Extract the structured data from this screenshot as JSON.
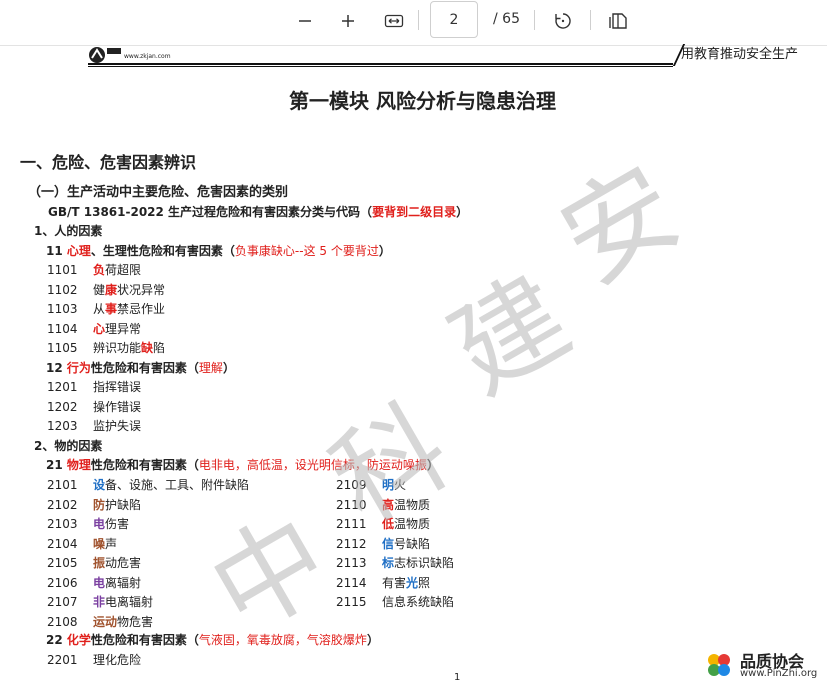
{
  "toolbar": {
    "zoom_out_icon": "minus-icon",
    "zoom_in_icon": "plus-icon",
    "fit_width_icon": "fit-width-icon",
    "page_current": "2",
    "page_total": "/ 65",
    "rotate_icon": "rotate-icon",
    "two_page_icon": "page-view-icon"
  },
  "header": {
    "logo_url": "www.zkjan.com",
    "motto": "用教育推动安全生产"
  },
  "doc": {
    "title": "第一模块   风险分析与隐患治理",
    "sec1": "一、危险、危害因素辨识",
    "sub1": "（一）生产活动中主要危险、危害因素的类别",
    "std_a": "GB/T 13861-2022 生产过程危险和有害因素分类与代码（",
    "std_b": "要背到二级目录",
    "std_c": "）",
    "p1": "1、人的因素",
    "g11_code": "11 ",
    "g11_a": "心理",
    "g11_b": "、生理性危险和有害因素（",
    "g11_c": "负事康缺心--这 5 个要背过",
    "g11_d": "）",
    "items11": [
      {
        "code": "1101",
        "pre": "",
        "hl": "负",
        "post": "荷超限"
      },
      {
        "code": "1102",
        "pre": "健",
        "hl": "康",
        "post": "状况异常"
      },
      {
        "code": "1103",
        "pre": "从",
        "hl": "事",
        "post": "禁忌作业"
      },
      {
        "code": "1104",
        "pre": "",
        "hl": "心",
        "post": "理异常"
      },
      {
        "code": "1105",
        "pre": "辨识功能",
        "hl": "缺",
        "post": "陷"
      }
    ],
    "g12_code": "12  ",
    "g12_a": "行为",
    "g12_b": "性危险和有害因素（",
    "g12_c": "理解",
    "g12_d": "）",
    "items12": [
      {
        "code": "1201",
        "text": "指挥错误"
      },
      {
        "code": "1202",
        "text": "操作错误"
      },
      {
        "code": "1203",
        "text": "监护失误"
      }
    ],
    "p2": "2、物的因素",
    "g21_code": "21  ",
    "g21_a": "物理",
    "g21_b": "性危险和有害因素（",
    "g21_c": "电非电，高低温，设光明信标，防运动噪振",
    "g21_d": "）",
    "items21_left": [
      {
        "code": "2101",
        "hl": "设",
        "post": "备、设施、工具、附件缺陷",
        "color": "blue"
      },
      {
        "code": "2102",
        "hl": "防",
        "post": "护缺陷",
        "color": "brown"
      },
      {
        "code": "2103",
        "hl": "电",
        "post": "伤害",
        "color": "purple"
      },
      {
        "code": "2104",
        "hl": "噪",
        "post": "声",
        "color": "brown"
      },
      {
        "code": "2105",
        "hl": "振",
        "post": "动危害",
        "color": "brown"
      },
      {
        "code": "2106",
        "hl": "电",
        "post": "离辐射",
        "color": "purple"
      },
      {
        "code": "2107",
        "hl": "非",
        "post": "电离辐射",
        "color": "purple"
      },
      {
        "code": "2108",
        "hl": "运动",
        "post": "物危害",
        "color": "brown"
      }
    ],
    "items21_right": [
      {
        "code": "2109",
        "pre": "",
        "hl": "明",
        "post": "火",
        "color": "blue"
      },
      {
        "code": "2110",
        "pre": "",
        "hl": "高",
        "post": "温物质",
        "color": "red"
      },
      {
        "code": "2111",
        "pre": "",
        "hl": "低",
        "post": "温物质",
        "color": "red"
      },
      {
        "code": "2112",
        "pre": "",
        "hl": "信",
        "post": "号缺陷",
        "color": "blue"
      },
      {
        "code": "2113",
        "pre": "",
        "hl": "标",
        "post": "志标识缺陷",
        "color": "blue"
      },
      {
        "code": "2114",
        "pre": "有害",
        "hl": "光",
        "post": "照",
        "color": "blue"
      },
      {
        "code": "2115",
        "pre": "信息系统缺陷",
        "hl": "",
        "post": "",
        "color": "blue"
      }
    ],
    "g22_code": "22  ",
    "g22_a": "化学",
    "g22_b": "性危险和有害因素（",
    "g22_c": "气液固，氧毒放腐，气溶胶爆炸",
    "g22_d": "）",
    "item2201_code": "2201",
    "item2201_text": "理化危险",
    "page_number": "1"
  },
  "watermark": {
    "chars": [
      "中",
      "科",
      "建",
      "安"
    ]
  },
  "pinzhi": {
    "name": "品质协会",
    "url": "www.PinZhi.org"
  }
}
